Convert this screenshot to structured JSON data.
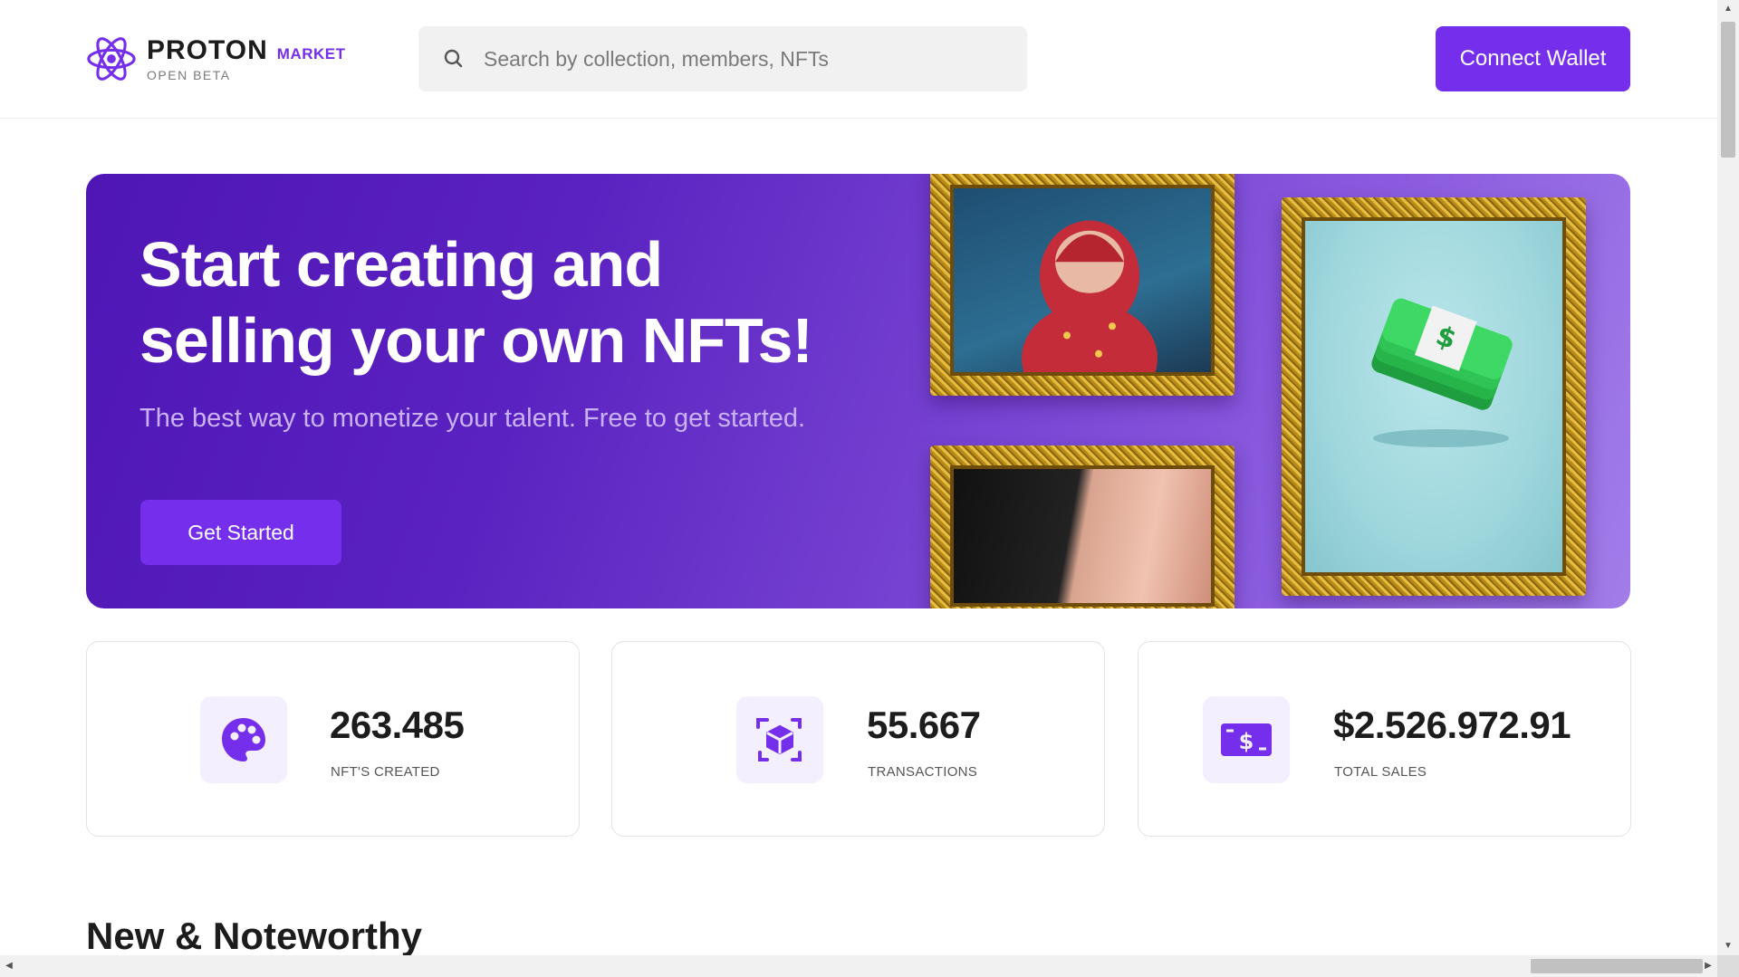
{
  "header": {
    "brand": "PROTON",
    "brand_sub": "MARKET",
    "beta_label": "OPEN BETA",
    "search_placeholder": "Search by collection, members, NFTs",
    "search_value": "",
    "connect_label": "Connect Wallet"
  },
  "hero": {
    "title_line1": "Start creating and",
    "title_line2": "selling your own NFTs!",
    "subtitle": "The best way to monetize your talent. Free to get started.",
    "button_label": "Get Started"
  },
  "stats": [
    {
      "value": "263.485",
      "label": "NFT'S CREATED",
      "icon": "palette-icon"
    },
    {
      "value": "55.667",
      "label": "TRANSACTIONS",
      "icon": "cube-scan-icon"
    },
    {
      "value": "$2.526.972.91",
      "label": "TOTAL SALES",
      "icon": "dollar-bill-icon"
    }
  ],
  "sections": {
    "new_noteworthy": "New & Noteworthy"
  },
  "colors": {
    "accent": "#752eeb",
    "hero_start": "#4f16b6",
    "hero_end": "#a27de9",
    "icon_bg": "#f3efff",
    "gold": "#e5bd3f"
  }
}
